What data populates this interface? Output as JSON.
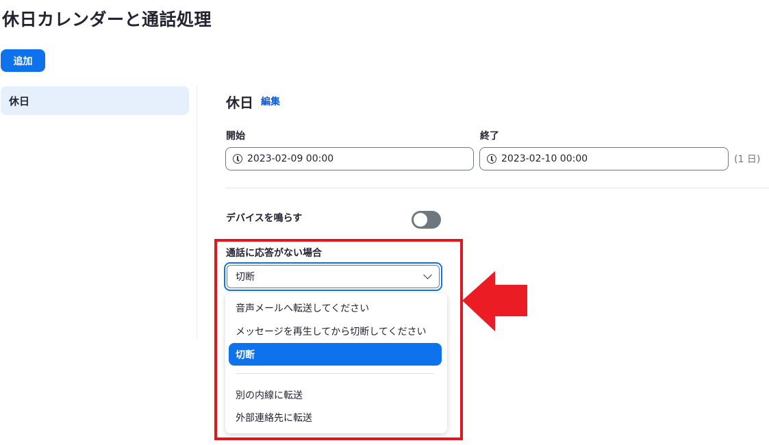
{
  "page": {
    "title": "休日カレンダーと通話処理"
  },
  "toolbar": {
    "add_label": "追加"
  },
  "sidebar": {
    "items": [
      {
        "label": "休日"
      }
    ]
  },
  "detail": {
    "title": "休日",
    "edit_label": "編集",
    "start": {
      "label": "開始",
      "value": "2023-02-09 00:00"
    },
    "end": {
      "label": "終了",
      "value": "2023-02-10 00:00"
    },
    "duration": "(1 日)",
    "ring_device": {
      "label": "デバイスを鳴らす",
      "enabled": false
    },
    "no_answer": {
      "label": "通話に応答がない場合",
      "selected": "切断",
      "options": [
        {
          "label": "音声メールへ転送してください"
        },
        {
          "label": "メッセージを再生してから切断してください"
        },
        {
          "label": "切断"
        },
        {
          "label": "別の内線に転送"
        },
        {
          "label": "外部連絡先に転送"
        }
      ]
    }
  },
  "colors": {
    "accent": "#0e72ed",
    "highlight": "#e3161d",
    "sidebar_active": "#e6f0fd"
  }
}
